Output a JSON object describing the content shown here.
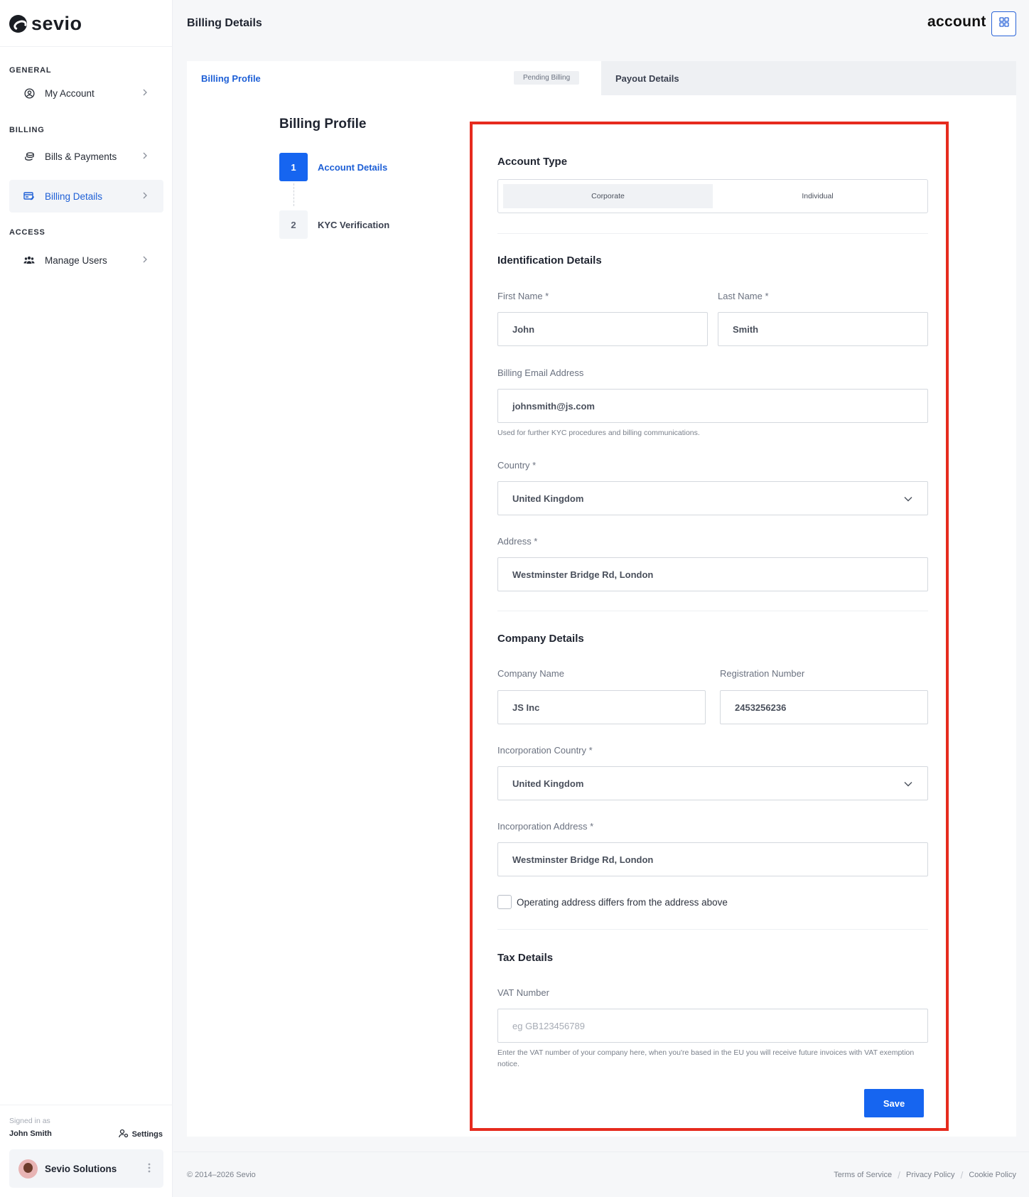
{
  "app": {
    "logo_text": "sevio",
    "page_title": "Billing Details",
    "brand_word": "account"
  },
  "sidebar": {
    "sections": [
      {
        "label": "GENERAL",
        "items": [
          {
            "label": "My Account",
            "icon": "user-circle-icon"
          }
        ]
      },
      {
        "label": "BILLING",
        "items": [
          {
            "label": "Bills & Payments",
            "icon": "coins-icon"
          },
          {
            "label": "Billing Details",
            "icon": "card-edit-icon",
            "active": true
          }
        ]
      },
      {
        "label": "ACCESS",
        "items": [
          {
            "label": "Manage Users",
            "icon": "users-icon"
          }
        ]
      }
    ],
    "signed_in_label": "Signed in as",
    "user_name": "John Smith",
    "settings_label": "Settings",
    "org_name": "Sevio Solutions"
  },
  "tabs": {
    "active": "Billing Profile",
    "badge": "Pending Billing",
    "inactive": "Payout Details"
  },
  "profile": {
    "title": "Billing Profile",
    "steps": [
      {
        "num": "1",
        "label": "Account Details"
      },
      {
        "num": "2",
        "label": "KYC Verification"
      }
    ]
  },
  "form": {
    "account_type": {
      "title": "Account Type",
      "options": [
        "Corporate",
        "Individual"
      ],
      "selected": "Corporate"
    },
    "identification": {
      "title": "Identification Details",
      "first_name_label": "First Name *",
      "first_name": "John",
      "last_name_label": "Last Name *",
      "last_name": "Smith",
      "email_label": "Billing Email Address",
      "email": "johnsmith@js.com",
      "email_help": "Used for further KYC procedures and billing communications.",
      "country_label": "Country *",
      "country": "United Kingdom",
      "address_label": "Address *",
      "address": "Westminster Bridge Rd, London"
    },
    "company": {
      "title": "Company Details",
      "name_label": "Company Name",
      "name": "JS Inc",
      "reg_label": "Registration Number",
      "reg": "2453256236",
      "inc_country_label": "Incorporation Country *",
      "inc_country": "United Kingdom",
      "inc_address_label": "Incorporation Address *",
      "inc_address": "Westminster Bridge Rd, London",
      "checkbox_label": "Operating address differs from the address above"
    },
    "tax": {
      "title": "Tax Details",
      "vat_label": "VAT Number",
      "vat_placeholder": "eg GB123456789",
      "vat_help": "Enter the VAT number of your company here, when you're based in the EU you will receive future invoices with VAT exemption notice."
    },
    "save_label": "Save"
  },
  "footer": {
    "copyright": "© 2014–2026 Sevio",
    "links": [
      "Terms of Service",
      "Privacy Policy",
      "Cookie Policy"
    ]
  },
  "colors": {
    "accent": "#1665f0",
    "highlight_border": "#e62b1e"
  }
}
